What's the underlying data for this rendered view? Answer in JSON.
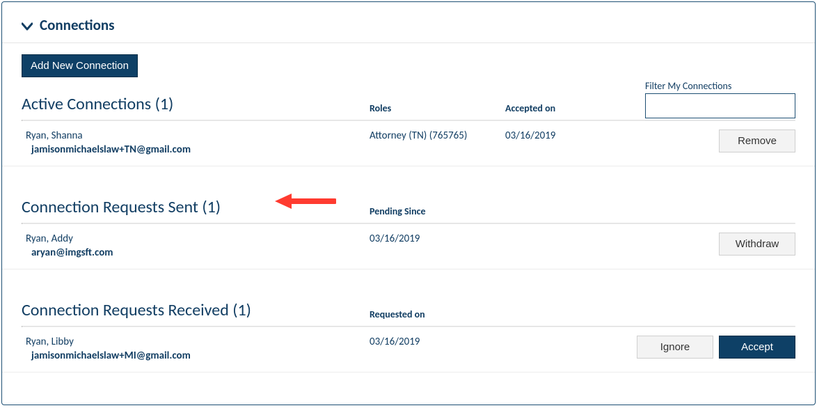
{
  "panel": {
    "title": "Connections"
  },
  "toolbar": {
    "add_label": "Add New Connection"
  },
  "filter": {
    "label": "Filter My Connections",
    "value": ""
  },
  "active": {
    "title": "Active Connections (1)",
    "col_roles": "Roles",
    "col_accepted": "Accepted on",
    "row": {
      "name": "Ryan, Shanna",
      "email": "jamisonmichaelslaw+TN@gmail.com",
      "roles": "Attorney (TN) (765765)",
      "date": "03/16/2019",
      "remove": "Remove"
    }
  },
  "sent": {
    "title": "Connection Requests Sent (1)",
    "col_pending": "Pending Since",
    "row": {
      "name": "Ryan, Addy",
      "email": "aryan@imgsft.com",
      "date": "03/16/2019",
      "withdraw": "Withdraw"
    }
  },
  "received": {
    "title": "Connection Requests Received (1)",
    "col_requested": "Requested on",
    "row": {
      "name": "Ryan, Libby",
      "email": "jamisonmichaelslaw+MI@gmail.com",
      "date": "03/16/2019",
      "ignore": "Ignore",
      "accept": "Accept"
    }
  }
}
